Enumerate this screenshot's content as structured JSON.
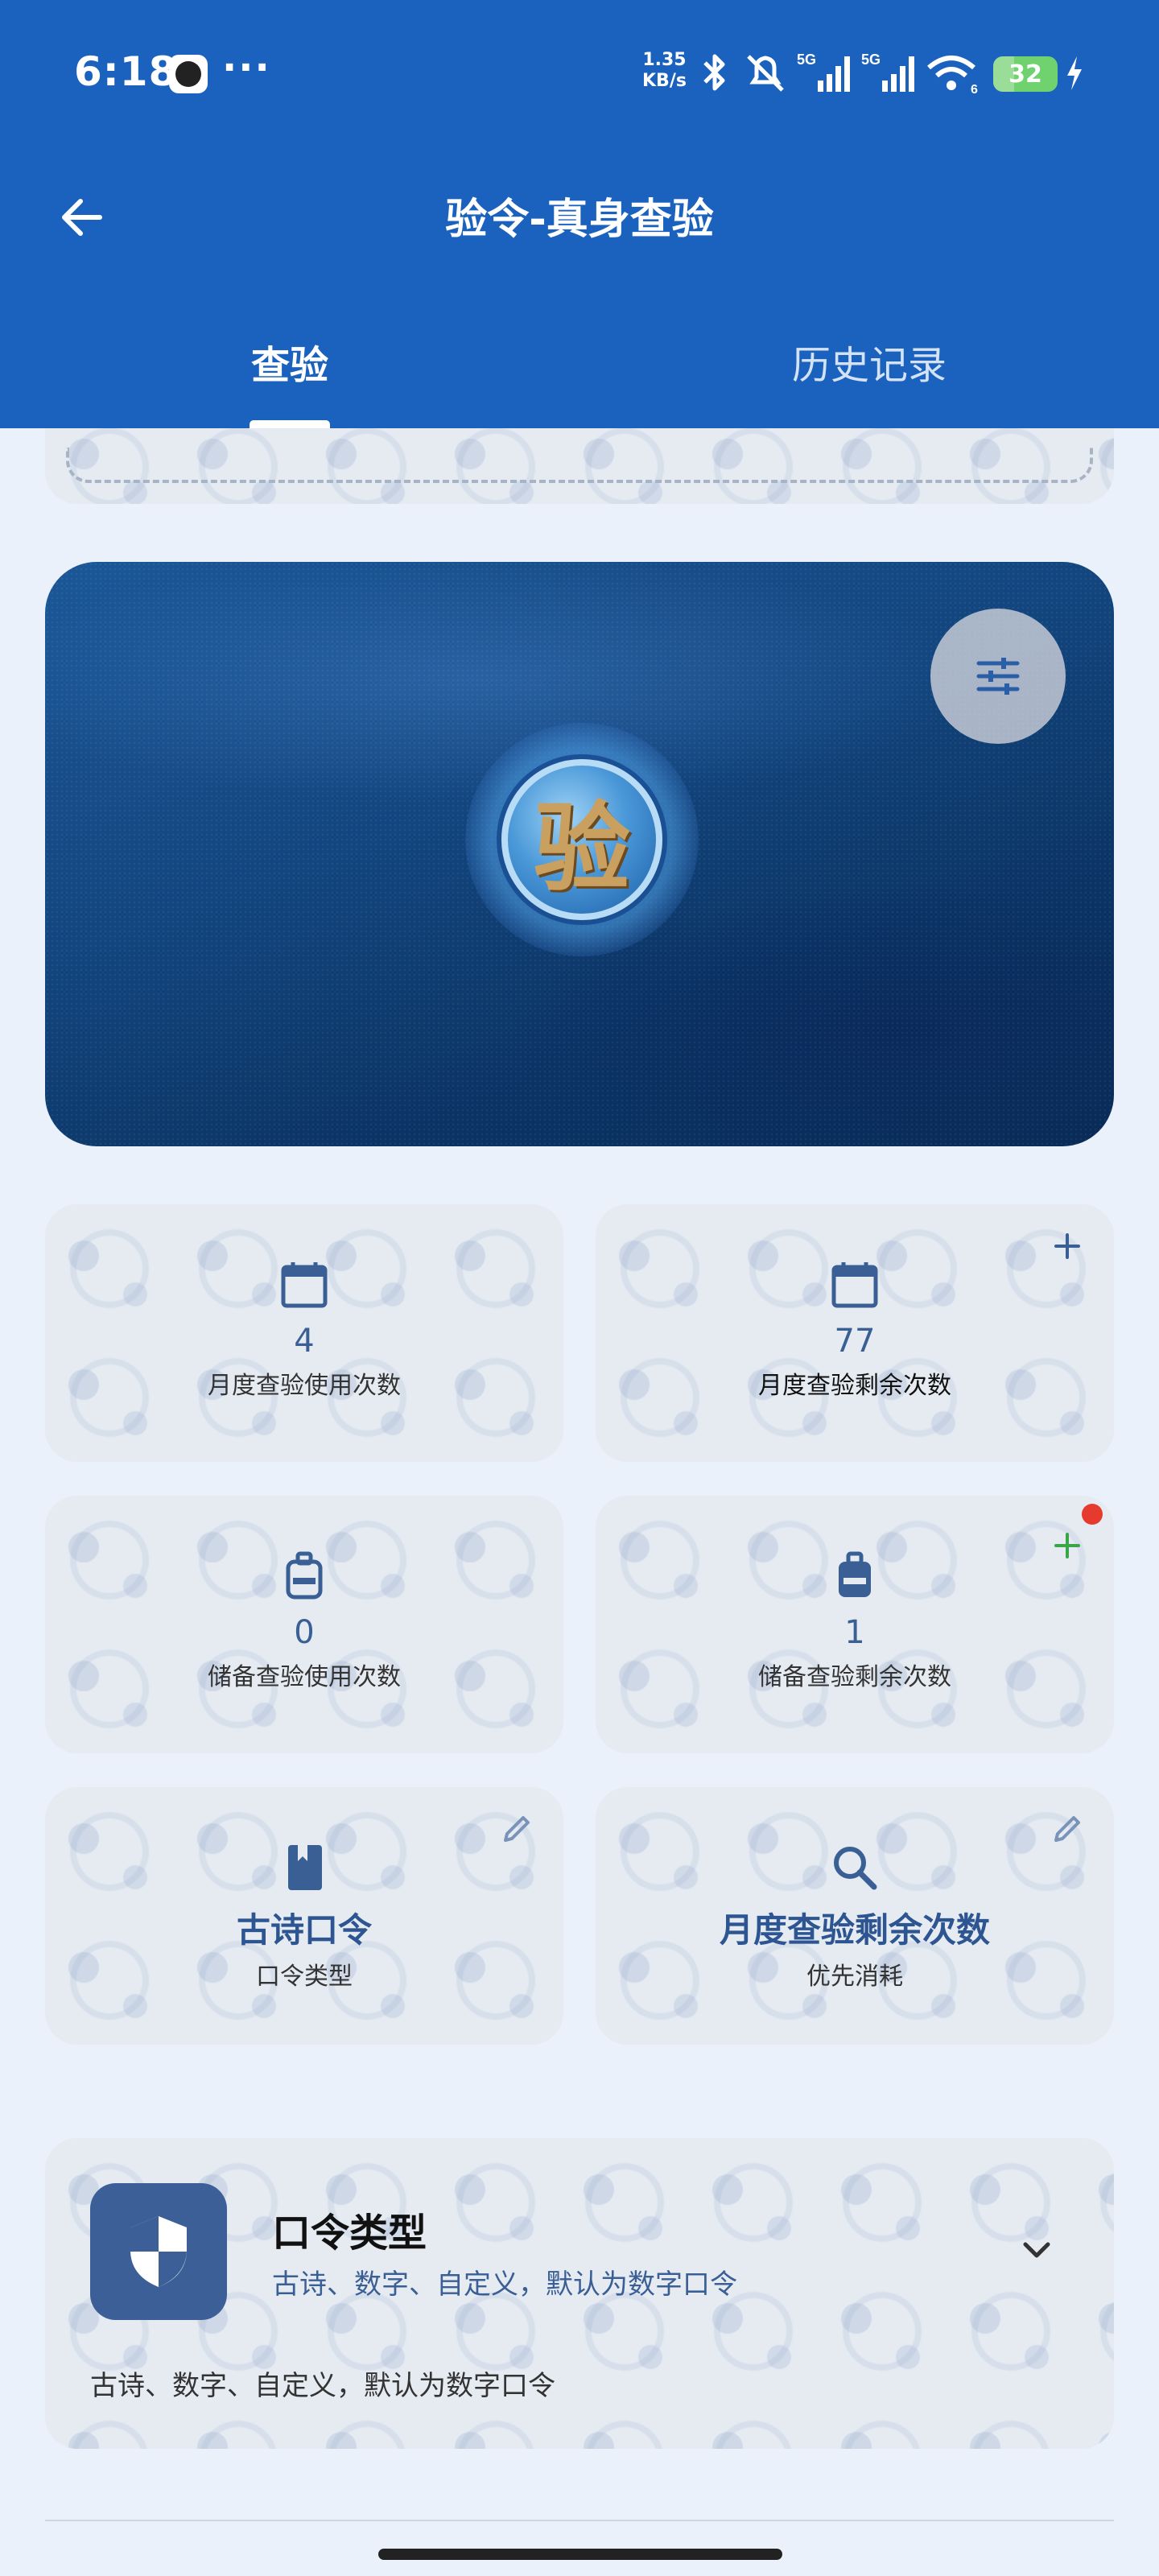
{
  "status_bar": {
    "time": "6:18",
    "more": "···",
    "net_speed_value": "1.35",
    "net_speed_unit": "KB/s",
    "signal1_label": "5G",
    "signal2_label": "5G",
    "wifi_label": "6",
    "battery": "32"
  },
  "header": {
    "title": "验令-真身查验"
  },
  "tabs": [
    {
      "label": "查验",
      "active": true
    },
    {
      "label": "历史记录",
      "active": false
    }
  ],
  "hero": {
    "seal_char": "验"
  },
  "stats": [
    {
      "value": "4",
      "label": "月度查验使用次数",
      "icon": "calendar-icon"
    },
    {
      "value": "77",
      "label": "月度查验剩余次数",
      "icon": "calendar-icon",
      "action": "add-icon"
    },
    {
      "value": "0",
      "label": "储备查验使用次数",
      "icon": "backpack-icon"
    },
    {
      "value": "1",
      "label": "储备查验剩余次数",
      "icon": "backpack-icon",
      "action": "add-icon",
      "badge": true
    }
  ],
  "settings": [
    {
      "value": "古诗口令",
      "label": "口令类型",
      "icon": "book-icon",
      "action": "edit-icon"
    },
    {
      "value": "月度查验剩余次数",
      "label": "优先消耗",
      "icon": "search-icon",
      "action": "edit-icon"
    }
  ],
  "info": {
    "title": "口令类型",
    "subtitle": "古诗、数字、自定义，默认为数字口令",
    "description": "古诗、数字、自定义，默认为数字口令",
    "icon": "shield-icon"
  },
  "colors": {
    "primary": "#1a62bd",
    "accent_text": "#3a5f95",
    "badge": "#e63a2f",
    "add_green": "#3aa64a"
  }
}
